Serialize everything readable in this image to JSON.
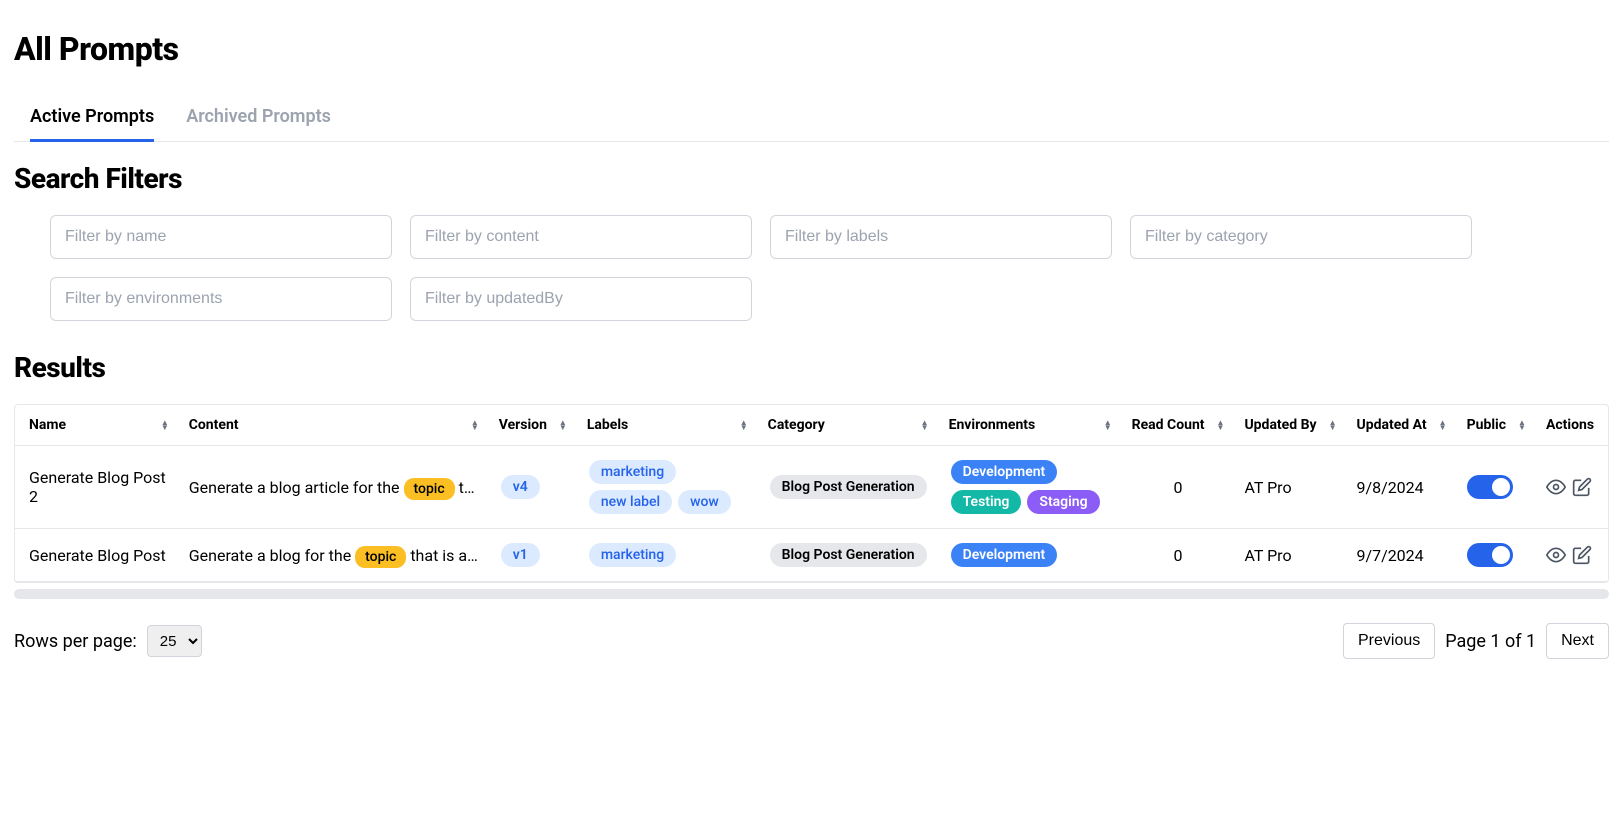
{
  "page_title": "All Prompts",
  "tabs": [
    {
      "label": "Active Prompts",
      "active": true
    },
    {
      "label": "Archived Prompts",
      "active": false
    }
  ],
  "search_filters_title": "Search Filters",
  "filters": [
    {
      "placeholder": "Filter by name"
    },
    {
      "placeholder": "Filter by content"
    },
    {
      "placeholder": "Filter by labels"
    },
    {
      "placeholder": "Filter by category"
    },
    {
      "placeholder": "Filter by environments"
    },
    {
      "placeholder": "Filter by updatedBy"
    }
  ],
  "results_title": "Results",
  "columns": [
    "Name",
    "Content",
    "Version",
    "Labels",
    "Category",
    "Environments",
    "Read Count",
    "Updated By",
    "Updated At",
    "Public",
    "Actions"
  ],
  "topic_chip_label": "topic",
  "rows": [
    {
      "name": "Generate Blog Post 2",
      "content_prefix": "Generate a blog article for the ",
      "content_suffix": " th…",
      "version": "v4",
      "labels": [
        "marketing",
        "new label",
        "wow"
      ],
      "category": "Blog Post Generation",
      "environments": [
        {
          "name": "Development",
          "style": "dev"
        },
        {
          "name": "Testing",
          "style": "test"
        },
        {
          "name": "Staging",
          "style": "stage"
        }
      ],
      "read_count": "0",
      "updated_by": "AT Pro",
      "updated_at": "9/8/2024",
      "public": true
    },
    {
      "name": "Generate Blog Post",
      "content_prefix": "Generate a blog for the ",
      "content_suffix": " that is atl…",
      "version": "v1",
      "labels": [
        "marketing"
      ],
      "category": "Blog Post Generation",
      "environments": [
        {
          "name": "Development",
          "style": "dev"
        }
      ],
      "read_count": "0",
      "updated_by": "AT Pro",
      "updated_at": "9/7/2024",
      "public": true
    }
  ],
  "pagination": {
    "rows_per_page_label": "Rows per page:",
    "rows_per_page_value": "25",
    "previous_label": "Previous",
    "page_info": "Page 1 of 1",
    "next_label": "Next"
  }
}
